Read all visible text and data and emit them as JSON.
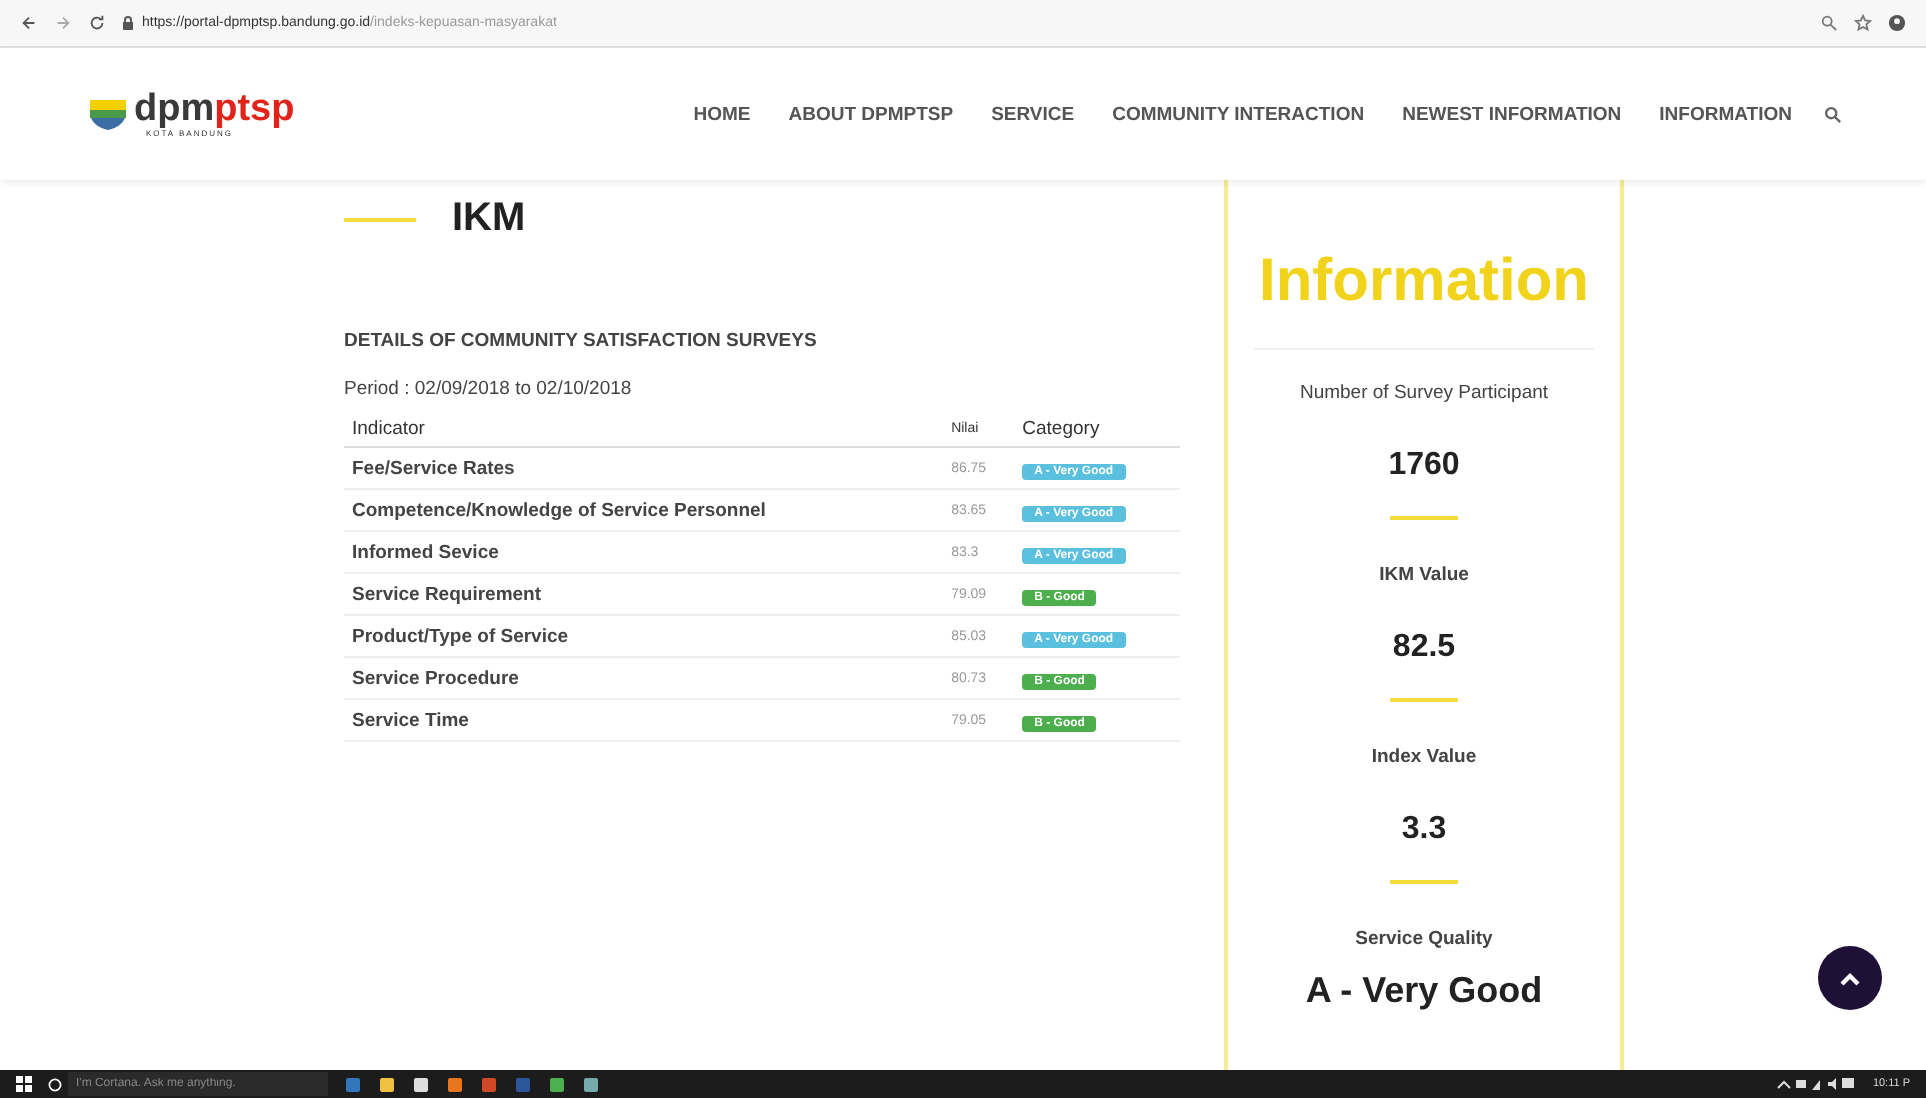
{
  "browser": {
    "url_host": "https://portal-dpmptsp.bandung.go.id",
    "url_path": "/indeks-kepuasan-masyarakat"
  },
  "header": {
    "logo": {
      "brand_dark": "dpm",
      "brand_red": "ptsp",
      "subtitle": "KOTA BANDUNG"
    },
    "nav": [
      {
        "label": "HOME"
      },
      {
        "label": "ABOUT DPMPTSP"
      },
      {
        "label": "SERVICE"
      },
      {
        "label": "COMMUNITY INTERACTION"
      },
      {
        "label": "NEWEST INFORMATION"
      },
      {
        "label": "INFORMATION"
      }
    ]
  },
  "main": {
    "title": "IKM",
    "heading": "DETAILS OF COMMUNITY SATISFACTION SURVEYS",
    "period": "Period : 02/09/2018 to 02/10/2018",
    "table": {
      "columns": [
        "Indicator",
        "Nilai",
        "Category"
      ],
      "rows": [
        {
          "indicator": "Fee/Service Rates",
          "value": "86.75",
          "category": "A - Very Good",
          "color": "#5bc0de"
        },
        {
          "indicator": "Competence/Knowledge of Service Personnel",
          "value": "83.65",
          "category": "A - Very Good",
          "color": "#5bc0de"
        },
        {
          "indicator": "Informed Sevice",
          "value": "83.3",
          "category": "A - Very Good",
          "color": "#5bc0de"
        },
        {
          "indicator": "Service Requirement",
          "value": "79.09",
          "category": "B - Good",
          "color": "#4cae4c"
        },
        {
          "indicator": "Product/Type of Service",
          "value": "85.03",
          "category": "A - Very Good",
          "color": "#5bc0de"
        },
        {
          "indicator": "Service Procedure",
          "value": "80.73",
          "category": "B - Good",
          "color": "#4cae4c"
        },
        {
          "indicator": "Service Time",
          "value": "79.05",
          "category": "B - Good",
          "color": "#4cae4c"
        }
      ]
    }
  },
  "sidebar": {
    "title": "Information",
    "stats": [
      {
        "label": "Number of Survey Participant",
        "value": "1760"
      },
      {
        "label": "IKM Value",
        "value": "82.5"
      },
      {
        "label": "Index Value",
        "value": "3.3"
      },
      {
        "label": "Service Quality",
        "value": "A - Very Good"
      }
    ]
  },
  "taskbar": {
    "search": {
      "placeholder": "I'm Cortana. Ask me anything."
    },
    "time": "10:11 P"
  }
}
